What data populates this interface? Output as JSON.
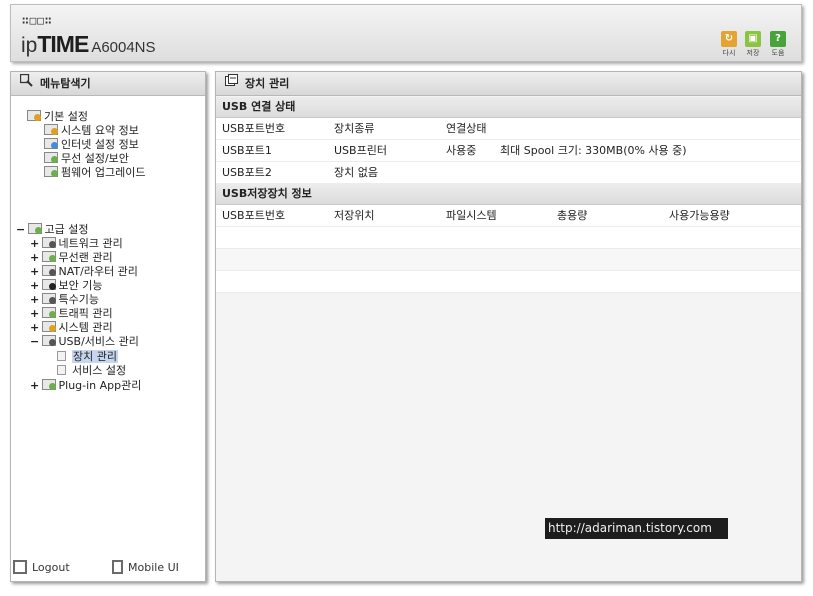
{
  "header": {
    "brand_dots": "∷□□∷",
    "brand_prefix": "ip",
    "brand_main": "TIME",
    "brand_model": "A6004NS",
    "buttons": [
      {
        "label": "다시",
        "icon": "refresh-icon",
        "glyph": "↻",
        "color": "#e3a431"
      },
      {
        "label": "저장",
        "icon": "save-icon",
        "glyph": "▣",
        "color": "#8cc341"
      },
      {
        "label": "도움",
        "icon": "help-icon",
        "glyph": "?",
        "color": "#48a33a"
      }
    ]
  },
  "left_panel": {
    "title": "메뉴탐색기",
    "basic": {
      "label": "기본 설정",
      "items": [
        "시스템 요약 정보",
        "인터넷 설정 정보",
        "무선 설정/보안",
        "펌웨어 업그레이드"
      ]
    },
    "advanced": {
      "label": "고급 설정",
      "items": [
        {
          "label": "네트워크 관리",
          "expander": "+"
        },
        {
          "label": "무선랜 관리",
          "expander": "+"
        },
        {
          "label": "NAT/라우터 관리",
          "expander": "+"
        },
        {
          "label": "보안 기능",
          "expander": "+"
        },
        {
          "label": "특수기능",
          "expander": "+"
        },
        {
          "label": "트래픽 관리",
          "expander": "+"
        },
        {
          "label": "시스템 관리",
          "expander": "+"
        },
        {
          "label": "USB/서비스 관리",
          "expander": "−"
        },
        {
          "label": "Plug-in App관리",
          "expander": "+"
        }
      ],
      "usb_children": [
        "장치 관리",
        "서비스 설정"
      ],
      "expander": "−"
    },
    "footer": {
      "logout": "Logout",
      "mobile": "Mobile UI"
    }
  },
  "right_panel": {
    "title": "장치 관리",
    "usb_status": {
      "heading": "USB 연결 상태",
      "columns": [
        "USB포트번호",
        "장치종류",
        "연결상태"
      ],
      "rows": [
        {
          "port": "USB포트1",
          "device": "USB프린터",
          "state": "사용중",
          "extra": "최대 Spool 크기: 330MB(0% 사용 중)"
        },
        {
          "port": "USB포트2",
          "device": "장치 없음",
          "state": "",
          "extra": ""
        }
      ]
    },
    "storage": {
      "heading": "USB저장장치 정보",
      "columns": [
        "USB포트번호",
        "저장위치",
        "파일시스템",
        "총용량",
        "사용가능용량"
      ]
    }
  },
  "watermark": "http://adariman.tistory.com"
}
